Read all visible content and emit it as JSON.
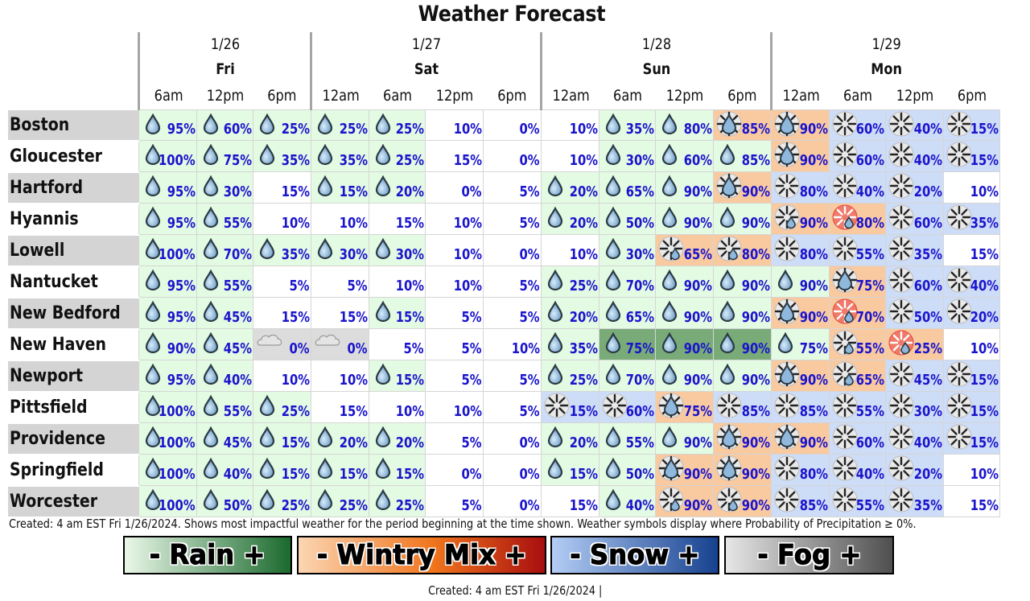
{
  "title": "Weather Forecast",
  "days": [
    {
      "date": "1/26",
      "day": "Fri",
      "times": [
        "6am",
        "12pm",
        "6pm"
      ]
    },
    {
      "date": "1/27",
      "day": "Sat",
      "times": [
        "12am",
        "6am",
        "12pm",
        "6pm"
      ]
    },
    {
      "date": "1/28",
      "day": "Sun",
      "times": [
        "12am",
        "6am",
        "12pm",
        "6pm"
      ]
    },
    {
      "date": "1/29",
      "day": "Mon",
      "times": [
        "12am",
        "6am",
        "12pm",
        "6pm"
      ]
    }
  ],
  "colors": {
    "percent_text": "#1a14cc",
    "rain": "#e3fae3",
    "rain_heavy": "#78ab78",
    "wintry_mix": "#f9c9a0",
    "snow": "#cddcf7",
    "fog": "#dcdcdc",
    "none": "#ffffff"
  },
  "icon_legend": {
    "R": {
      "icon": "rain-drop-icon",
      "bg": "rain"
    },
    "RH": {
      "icon": "rain-drop-icon",
      "bg": "rain_heavy"
    },
    "S": {
      "icon": "snowflake-icon",
      "bg": "snow"
    },
    "M": {
      "icon": "snow-rain-mix-icon",
      "bg": "wintry_mix"
    },
    "SR": {
      "icon": "snowflake-raindrop-icon",
      "bg": "wintry_mix"
    },
    "SRS": {
      "icon": "snowflake-raindrop-icon",
      "bg": "snow"
    },
    "FR": {
      "icon": "freezing-rain-icon",
      "bg": "wintry_mix"
    },
    "F": {
      "icon": "fog-cloud-icon",
      "bg": "fog"
    },
    "N": {
      "icon": null,
      "bg": "none"
    }
  },
  "rows": [
    {
      "city": "Boston",
      "cells": [
        [
          "R",
          "95%"
        ],
        [
          "R",
          "60%"
        ],
        [
          "R",
          "25%"
        ],
        [
          "R",
          "25%"
        ],
        [
          "R",
          "25%"
        ],
        [
          "N",
          "10%"
        ],
        [
          "N",
          "0%"
        ],
        [
          "N",
          "10%"
        ],
        [
          "R",
          "35%"
        ],
        [
          "R",
          "80%"
        ],
        [
          "M",
          "85%"
        ],
        [
          "M",
          "90%"
        ],
        [
          "S",
          "60%"
        ],
        [
          "S",
          "40%"
        ],
        [
          "S",
          "15%"
        ]
      ]
    },
    {
      "city": "Gloucester",
      "cells": [
        [
          "R",
          "100%"
        ],
        [
          "R",
          "75%"
        ],
        [
          "R",
          "35%"
        ],
        [
          "R",
          "35%"
        ],
        [
          "R",
          "25%"
        ],
        [
          "N",
          "15%"
        ],
        [
          "N",
          "0%"
        ],
        [
          "N",
          "10%"
        ],
        [
          "R",
          "30%"
        ],
        [
          "R",
          "60%"
        ],
        [
          "R",
          "85%"
        ],
        [
          "M",
          "90%"
        ],
        [
          "S",
          "60%"
        ],
        [
          "S",
          "40%"
        ],
        [
          "S",
          "15%"
        ]
      ]
    },
    {
      "city": "Hartford",
      "cells": [
        [
          "R",
          "95%"
        ],
        [
          "R",
          "30%"
        ],
        [
          "N",
          "15%"
        ],
        [
          "R",
          "15%"
        ],
        [
          "R",
          "20%"
        ],
        [
          "N",
          "0%"
        ],
        [
          "N",
          "5%"
        ],
        [
          "R",
          "20%"
        ],
        [
          "R",
          "65%"
        ],
        [
          "R",
          "90%"
        ],
        [
          "M",
          "90%"
        ],
        [
          "S",
          "80%"
        ],
        [
          "S",
          "40%"
        ],
        [
          "S",
          "20%"
        ],
        [
          "N",
          "10%"
        ]
      ]
    },
    {
      "city": "Hyannis",
      "cells": [
        [
          "R",
          "95%"
        ],
        [
          "R",
          "55%"
        ],
        [
          "N",
          "10%"
        ],
        [
          "N",
          "10%"
        ],
        [
          "N",
          "15%"
        ],
        [
          "N",
          "10%"
        ],
        [
          "N",
          "5%"
        ],
        [
          "R",
          "20%"
        ],
        [
          "R",
          "50%"
        ],
        [
          "R",
          "90%"
        ],
        [
          "R",
          "90%"
        ],
        [
          "SR",
          "90%"
        ],
        [
          "FR",
          "80%"
        ],
        [
          "S",
          "60%"
        ],
        [
          "S",
          "35%"
        ]
      ]
    },
    {
      "city": "Lowell",
      "cells": [
        [
          "R",
          "100%"
        ],
        [
          "R",
          "70%"
        ],
        [
          "R",
          "35%"
        ],
        [
          "R",
          "30%"
        ],
        [
          "R",
          "30%"
        ],
        [
          "N",
          "10%"
        ],
        [
          "N",
          "0%"
        ],
        [
          "N",
          "10%"
        ],
        [
          "R",
          "30%"
        ],
        [
          "SR",
          "65%"
        ],
        [
          "SR",
          "80%"
        ],
        [
          "S",
          "80%"
        ],
        [
          "S",
          "55%"
        ],
        [
          "S",
          "35%"
        ],
        [
          "N",
          "15%"
        ]
      ]
    },
    {
      "city": "Nantucket",
      "cells": [
        [
          "R",
          "95%"
        ],
        [
          "R",
          "55%"
        ],
        [
          "N",
          "5%"
        ],
        [
          "N",
          "5%"
        ],
        [
          "N",
          "10%"
        ],
        [
          "N",
          "10%"
        ],
        [
          "N",
          "5%"
        ],
        [
          "R",
          "25%"
        ],
        [
          "R",
          "70%"
        ],
        [
          "R",
          "90%"
        ],
        [
          "R",
          "90%"
        ],
        [
          "R",
          "90%"
        ],
        [
          "M",
          "75%"
        ],
        [
          "S",
          "60%"
        ],
        [
          "S",
          "40%"
        ]
      ]
    },
    {
      "city": "New Bedford",
      "cells": [
        [
          "R",
          "95%"
        ],
        [
          "R",
          "45%"
        ],
        [
          "N",
          "15%"
        ],
        [
          "N",
          "15%"
        ],
        [
          "R",
          "15%"
        ],
        [
          "N",
          "5%"
        ],
        [
          "N",
          "5%"
        ],
        [
          "R",
          "20%"
        ],
        [
          "R",
          "65%"
        ],
        [
          "R",
          "90%"
        ],
        [
          "R",
          "90%"
        ],
        [
          "M",
          "90%"
        ],
        [
          "FR",
          "70%"
        ],
        [
          "S",
          "50%"
        ],
        [
          "S",
          "20%"
        ]
      ]
    },
    {
      "city": "New Haven",
      "cells": [
        [
          "R",
          "90%"
        ],
        [
          "R",
          "45%"
        ],
        [
          "F",
          "0%"
        ],
        [
          "F",
          "0%"
        ],
        [
          "N",
          "5%"
        ],
        [
          "N",
          "5%"
        ],
        [
          "N",
          "10%"
        ],
        [
          "R",
          "35%"
        ],
        [
          "RH",
          "75%"
        ],
        [
          "RH",
          "90%"
        ],
        [
          "RH",
          "90%"
        ],
        [
          "R",
          "75%"
        ],
        [
          "SR",
          "55%"
        ],
        [
          "FR",
          "25%"
        ],
        [
          "N",
          "10%"
        ]
      ]
    },
    {
      "city": "Newport",
      "cells": [
        [
          "R",
          "95%"
        ],
        [
          "R",
          "40%"
        ],
        [
          "N",
          "10%"
        ],
        [
          "N",
          "10%"
        ],
        [
          "R",
          "15%"
        ],
        [
          "N",
          "5%"
        ],
        [
          "N",
          "5%"
        ],
        [
          "R",
          "25%"
        ],
        [
          "R",
          "70%"
        ],
        [
          "R",
          "90%"
        ],
        [
          "R",
          "90%"
        ],
        [
          "M",
          "90%"
        ],
        [
          "SR",
          "65%"
        ],
        [
          "S",
          "45%"
        ],
        [
          "S",
          "15%"
        ]
      ]
    },
    {
      "city": "Pittsfield",
      "cells": [
        [
          "R",
          "100%"
        ],
        [
          "R",
          "55%"
        ],
        [
          "R",
          "25%"
        ],
        [
          "N",
          "15%"
        ],
        [
          "N",
          "10%"
        ],
        [
          "N",
          "10%"
        ],
        [
          "N",
          "5%"
        ],
        [
          "S",
          "15%"
        ],
        [
          "S",
          "60%"
        ],
        [
          "M",
          "75%"
        ],
        [
          "S",
          "85%"
        ],
        [
          "S",
          "85%"
        ],
        [
          "S",
          "55%"
        ],
        [
          "S",
          "30%"
        ],
        [
          "S",
          "15%"
        ]
      ]
    },
    {
      "city": "Providence",
      "cells": [
        [
          "R",
          "100%"
        ],
        [
          "R",
          "45%"
        ],
        [
          "R",
          "15%"
        ],
        [
          "R",
          "20%"
        ],
        [
          "R",
          "20%"
        ],
        [
          "N",
          "5%"
        ],
        [
          "N",
          "0%"
        ],
        [
          "R",
          "20%"
        ],
        [
          "R",
          "55%"
        ],
        [
          "R",
          "90%"
        ],
        [
          "M",
          "90%"
        ],
        [
          "M",
          "90%"
        ],
        [
          "S",
          "60%"
        ],
        [
          "S",
          "40%"
        ],
        [
          "S",
          "15%"
        ]
      ]
    },
    {
      "city": "Springfield",
      "cells": [
        [
          "R",
          "100%"
        ],
        [
          "R",
          "40%"
        ],
        [
          "R",
          "15%"
        ],
        [
          "R",
          "15%"
        ],
        [
          "R",
          "15%"
        ],
        [
          "N",
          "0%"
        ],
        [
          "N",
          "0%"
        ],
        [
          "R",
          "15%"
        ],
        [
          "R",
          "50%"
        ],
        [
          "M",
          "90%"
        ],
        [
          "M",
          "90%"
        ],
        [
          "S",
          "80%"
        ],
        [
          "S",
          "40%"
        ],
        [
          "S",
          "20%"
        ],
        [
          "N",
          "10%"
        ]
      ]
    },
    {
      "city": "Worcester",
      "cells": [
        [
          "R",
          "100%"
        ],
        [
          "R",
          "50%"
        ],
        [
          "R",
          "25%"
        ],
        [
          "R",
          "25%"
        ],
        [
          "R",
          "25%"
        ],
        [
          "N",
          "5%"
        ],
        [
          "N",
          "0%"
        ],
        [
          "N",
          "15%"
        ],
        [
          "R",
          "40%"
        ],
        [
          "SR",
          "90%"
        ],
        [
          "SR",
          "90%"
        ],
        [
          "S",
          "85%"
        ],
        [
          "S",
          "55%"
        ],
        [
          "S",
          "35%"
        ],
        [
          "N",
          "15%"
        ]
      ]
    }
  ],
  "note": "Created: 4 am EST Fri 1/26/2024. Shows most impactful weather for the period beginning at the time shown. Weather symbols display where Probability of Precipitation ≥ 0%.",
  "legend": [
    {
      "label": "- Rain +",
      "name": "legend-rain"
    },
    {
      "label": "- Wintry Mix +",
      "name": "legend-wintry-mix"
    },
    {
      "label": "- Snow +",
      "name": "legend-snow"
    },
    {
      "label": "- Fog +",
      "name": "legend-fog"
    }
  ],
  "created": "Created: 4 am EST Fri 1/26/2024  |"
}
